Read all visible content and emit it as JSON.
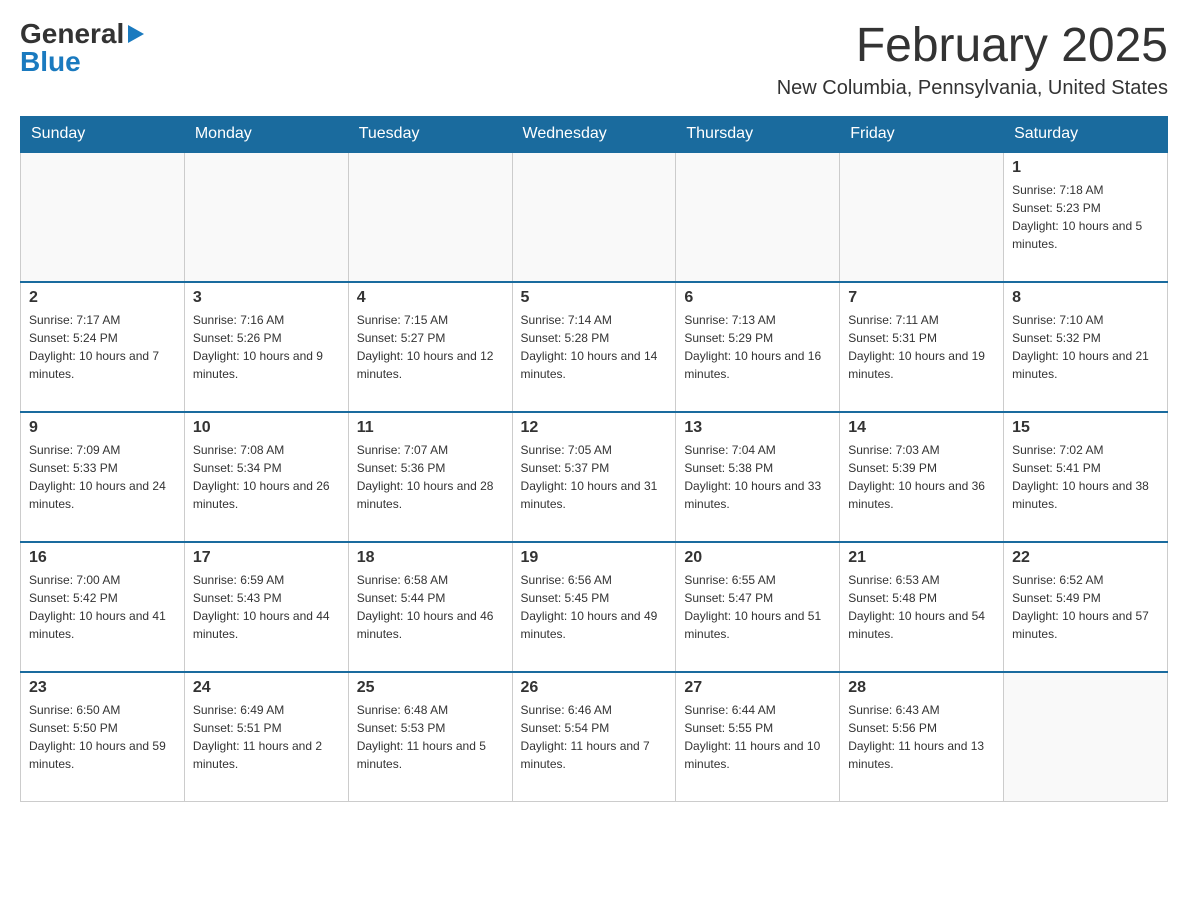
{
  "header": {
    "logo_general": "General",
    "logo_blue": "Blue",
    "month_title": "February 2025",
    "location": "New Columbia, Pennsylvania, United States"
  },
  "days_of_week": [
    "Sunday",
    "Monday",
    "Tuesday",
    "Wednesday",
    "Thursday",
    "Friday",
    "Saturday"
  ],
  "weeks": [
    {
      "days": [
        {
          "date": "",
          "info": ""
        },
        {
          "date": "",
          "info": ""
        },
        {
          "date": "",
          "info": ""
        },
        {
          "date": "",
          "info": ""
        },
        {
          "date": "",
          "info": ""
        },
        {
          "date": "",
          "info": ""
        },
        {
          "date": "1",
          "info": "Sunrise: 7:18 AM\nSunset: 5:23 PM\nDaylight: 10 hours and 5 minutes."
        }
      ]
    },
    {
      "days": [
        {
          "date": "2",
          "info": "Sunrise: 7:17 AM\nSunset: 5:24 PM\nDaylight: 10 hours and 7 minutes."
        },
        {
          "date": "3",
          "info": "Sunrise: 7:16 AM\nSunset: 5:26 PM\nDaylight: 10 hours and 9 minutes."
        },
        {
          "date": "4",
          "info": "Sunrise: 7:15 AM\nSunset: 5:27 PM\nDaylight: 10 hours and 12 minutes."
        },
        {
          "date": "5",
          "info": "Sunrise: 7:14 AM\nSunset: 5:28 PM\nDaylight: 10 hours and 14 minutes."
        },
        {
          "date": "6",
          "info": "Sunrise: 7:13 AM\nSunset: 5:29 PM\nDaylight: 10 hours and 16 minutes."
        },
        {
          "date": "7",
          "info": "Sunrise: 7:11 AM\nSunset: 5:31 PM\nDaylight: 10 hours and 19 minutes."
        },
        {
          "date": "8",
          "info": "Sunrise: 7:10 AM\nSunset: 5:32 PM\nDaylight: 10 hours and 21 minutes."
        }
      ]
    },
    {
      "days": [
        {
          "date": "9",
          "info": "Sunrise: 7:09 AM\nSunset: 5:33 PM\nDaylight: 10 hours and 24 minutes."
        },
        {
          "date": "10",
          "info": "Sunrise: 7:08 AM\nSunset: 5:34 PM\nDaylight: 10 hours and 26 minutes."
        },
        {
          "date": "11",
          "info": "Sunrise: 7:07 AM\nSunset: 5:36 PM\nDaylight: 10 hours and 28 minutes."
        },
        {
          "date": "12",
          "info": "Sunrise: 7:05 AM\nSunset: 5:37 PM\nDaylight: 10 hours and 31 minutes."
        },
        {
          "date": "13",
          "info": "Sunrise: 7:04 AM\nSunset: 5:38 PM\nDaylight: 10 hours and 33 minutes."
        },
        {
          "date": "14",
          "info": "Sunrise: 7:03 AM\nSunset: 5:39 PM\nDaylight: 10 hours and 36 minutes."
        },
        {
          "date": "15",
          "info": "Sunrise: 7:02 AM\nSunset: 5:41 PM\nDaylight: 10 hours and 38 minutes."
        }
      ]
    },
    {
      "days": [
        {
          "date": "16",
          "info": "Sunrise: 7:00 AM\nSunset: 5:42 PM\nDaylight: 10 hours and 41 minutes."
        },
        {
          "date": "17",
          "info": "Sunrise: 6:59 AM\nSunset: 5:43 PM\nDaylight: 10 hours and 44 minutes."
        },
        {
          "date": "18",
          "info": "Sunrise: 6:58 AM\nSunset: 5:44 PM\nDaylight: 10 hours and 46 minutes."
        },
        {
          "date": "19",
          "info": "Sunrise: 6:56 AM\nSunset: 5:45 PM\nDaylight: 10 hours and 49 minutes."
        },
        {
          "date": "20",
          "info": "Sunrise: 6:55 AM\nSunset: 5:47 PM\nDaylight: 10 hours and 51 minutes."
        },
        {
          "date": "21",
          "info": "Sunrise: 6:53 AM\nSunset: 5:48 PM\nDaylight: 10 hours and 54 minutes."
        },
        {
          "date": "22",
          "info": "Sunrise: 6:52 AM\nSunset: 5:49 PM\nDaylight: 10 hours and 57 minutes."
        }
      ]
    },
    {
      "days": [
        {
          "date": "23",
          "info": "Sunrise: 6:50 AM\nSunset: 5:50 PM\nDaylight: 10 hours and 59 minutes."
        },
        {
          "date": "24",
          "info": "Sunrise: 6:49 AM\nSunset: 5:51 PM\nDaylight: 11 hours and 2 minutes."
        },
        {
          "date": "25",
          "info": "Sunrise: 6:48 AM\nSunset: 5:53 PM\nDaylight: 11 hours and 5 minutes."
        },
        {
          "date": "26",
          "info": "Sunrise: 6:46 AM\nSunset: 5:54 PM\nDaylight: 11 hours and 7 minutes."
        },
        {
          "date": "27",
          "info": "Sunrise: 6:44 AM\nSunset: 5:55 PM\nDaylight: 11 hours and 10 minutes."
        },
        {
          "date": "28",
          "info": "Sunrise: 6:43 AM\nSunset: 5:56 PM\nDaylight: 11 hours and 13 minutes."
        },
        {
          "date": "",
          "info": ""
        }
      ]
    }
  ]
}
